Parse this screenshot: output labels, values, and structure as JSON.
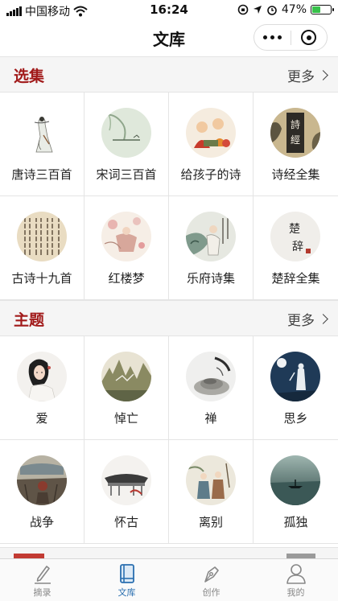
{
  "status_bar": {
    "carrier": "中国移动",
    "time": "16:24",
    "battery": "47%",
    "battery_level": 0.47
  },
  "nav": {
    "title": "文库"
  },
  "sections": {
    "collections": {
      "title": "选集",
      "more": "更多",
      "items": [
        {
          "label": "唐诗三百首"
        },
        {
          "label": "宋词三百首"
        },
        {
          "label": "给孩子的诗"
        },
        {
          "label": "诗经全集",
          "thumb_text": "诗經"
        },
        {
          "label": "古诗十九首"
        },
        {
          "label": "红楼梦"
        },
        {
          "label": "乐府诗集"
        },
        {
          "label": "楚辞全集",
          "thumb_text": "楚辞"
        }
      ]
    },
    "themes": {
      "title": "主题",
      "more": "更多",
      "items": [
        {
          "label": "爱"
        },
        {
          "label": "悼亡"
        },
        {
          "label": "禅"
        },
        {
          "label": "思乡"
        },
        {
          "label": "战争"
        },
        {
          "label": "怀古"
        },
        {
          "label": "离别"
        },
        {
          "label": "孤独"
        }
      ]
    }
  },
  "tabs": [
    {
      "label": "摘录",
      "icon": "pen-icon",
      "active": false
    },
    {
      "label": "文库",
      "icon": "book-icon",
      "active": true
    },
    {
      "label": "创作",
      "icon": "fountain-pen-icon",
      "active": false
    },
    {
      "label": "我的",
      "icon": "person-icon",
      "active": false
    }
  ],
  "colors": {
    "accent_red": "#a11a1a",
    "tab_active": "#2a6fb0",
    "tab_inactive": "#888888",
    "battery_green": "#37c14a"
  }
}
